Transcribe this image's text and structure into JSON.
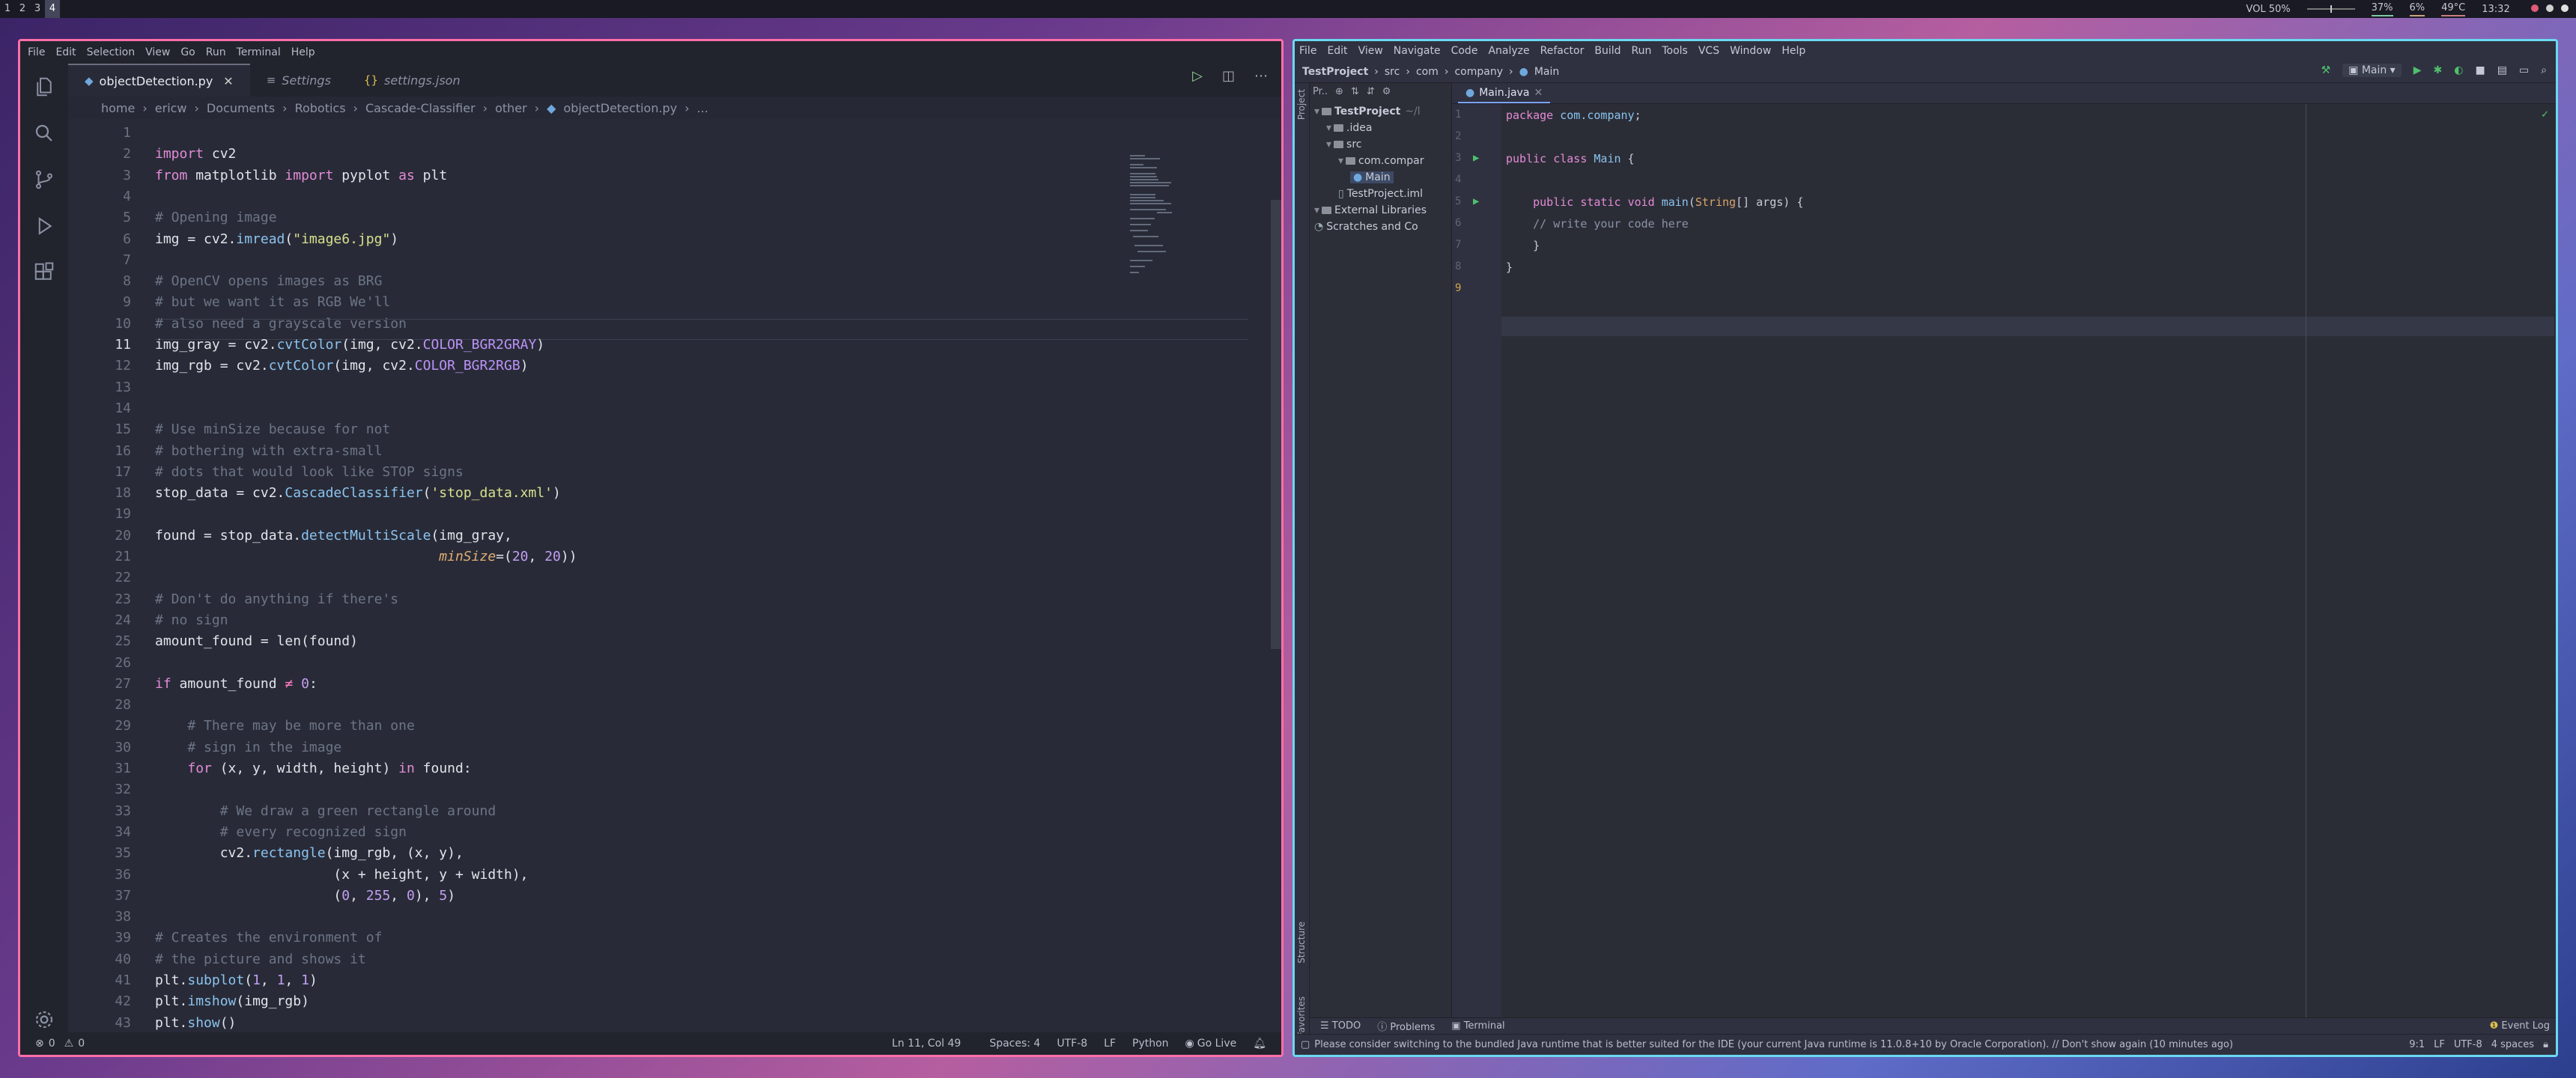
{
  "topbar": {
    "workspaces": [
      "1",
      "2",
      "3",
      "4"
    ],
    "volume": "VOL 50%",
    "volume_level": 0.5,
    "cpu": "37%",
    "mem": "6%",
    "temp": "49°C",
    "time": "13:32"
  },
  "vscode": {
    "menu": [
      "File",
      "Edit",
      "Selection",
      "View",
      "Go",
      "Run",
      "Terminal",
      "Help"
    ],
    "tabs": [
      {
        "label": "objectDetection.py",
        "icon": "python-icon",
        "active": true
      },
      {
        "label": "Settings",
        "icon": "settings-icon"
      },
      {
        "label": "settings.json",
        "icon": "json-icon"
      }
    ],
    "breadcrumb": [
      "home",
      "ericw",
      "Documents",
      "Robotics",
      "Cascade-Classifier",
      "other",
      "objectDetection.py",
      "..."
    ],
    "code_lines": [
      "",
      "import cv2",
      "from matplotlib import pyplot as plt",
      "",
      "# Opening image",
      "img = cv2.imread(\"image6.jpg\")",
      "",
      "# OpenCV opens images as BRG",
      "# but we want it as RGB We'll",
      "# also need a grayscale version",
      "img_gray = cv2.cvtColor(img, cv2.COLOR_BGR2GRAY)",
      "img_rgb = cv2.cvtColor(img, cv2.COLOR_BGR2RGB)",
      "",
      "",
      "# Use minSize because for not",
      "# bothering with extra-small",
      "# dots that would look like STOP signs",
      "stop_data = cv2.CascadeClassifier('stop_data.xml')",
      "",
      "found = stop_data.detectMultiScale(img_gray,",
      "                                   minSize=(20, 20))",
      "",
      "# Don't do anything if there's",
      "# no sign",
      "amount_found = len(found)",
      "",
      "if amount_found != 0:",
      "",
      "    # There may be more than one",
      "    # sign in the image",
      "    for (x, y, width, height) in found:",
      "",
      "        # We draw a green rectangle around",
      "        # every recognized sign",
      "        cv2.rectangle(img_rgb, (x, y),",
      "                      (x + height, y + width),",
      "                      (0, 255, 0), 5)",
      "",
      "# Creates the environment of",
      "# the picture and shows it",
      "plt.subplot(1, 1, 1)",
      "plt.imshow(img_rgb)",
      "plt.show()",
      ""
    ],
    "status": {
      "problems": "0",
      "warnings": "0",
      "position": "Ln 11, Col 49",
      "spaces": "Spaces: 4",
      "encoding": "UTF-8",
      "eol": "LF",
      "language": "Python",
      "golive": "Go Live"
    }
  },
  "idea": {
    "menu": [
      "File",
      "Edit",
      "View",
      "Navigate",
      "Code",
      "Analyze",
      "Refactor",
      "Build",
      "Run",
      "Tools",
      "VCS",
      "Window",
      "Help"
    ],
    "nav": [
      "TestProject",
      "src",
      "com",
      "company",
      "Main"
    ],
    "run_config": "Main",
    "project_tab": "Pr..",
    "tree": [
      {
        "label": "TestProject",
        "suffix": "~/l",
        "indent": 0,
        "kind": "project"
      },
      {
        "label": ".idea",
        "indent": 1,
        "kind": "folder"
      },
      {
        "label": "src",
        "indent": 1,
        "kind": "folder"
      },
      {
        "label": "com.compar",
        "indent": 2,
        "kind": "folder"
      },
      {
        "label": "Main",
        "indent": 3,
        "kind": "class",
        "selected": true
      },
      {
        "label": "TestProject.iml",
        "indent": 2,
        "kind": "file"
      },
      {
        "label": "External Libraries",
        "indent": 0,
        "kind": "lib"
      },
      {
        "label": "Scratches and Co",
        "indent": 0,
        "kind": "scratch"
      }
    ],
    "editor_tab": "Main.java",
    "java_lines": [
      "package com.company;",
      "",
      "public class Main {",
      "",
      "    public static void main(String[] args) {",
      "    // write your code here",
      "    }",
      "}",
      ""
    ],
    "side_labels": [
      "Project",
      "Structure",
      "Favorites"
    ],
    "tool_tabs": [
      "TODO",
      "Problems",
      "Terminal"
    ],
    "event_log": "Event Log",
    "status_msg": "Please consider switching to the bundled Java runtime that is better suited for the IDE (your current Java runtime is 11.0.8+10 by Oracle Corporation). // Don't show again (10 minutes ago)",
    "status_right": [
      "9:1",
      "LF",
      "UTF-8",
      "4 spaces"
    ]
  }
}
